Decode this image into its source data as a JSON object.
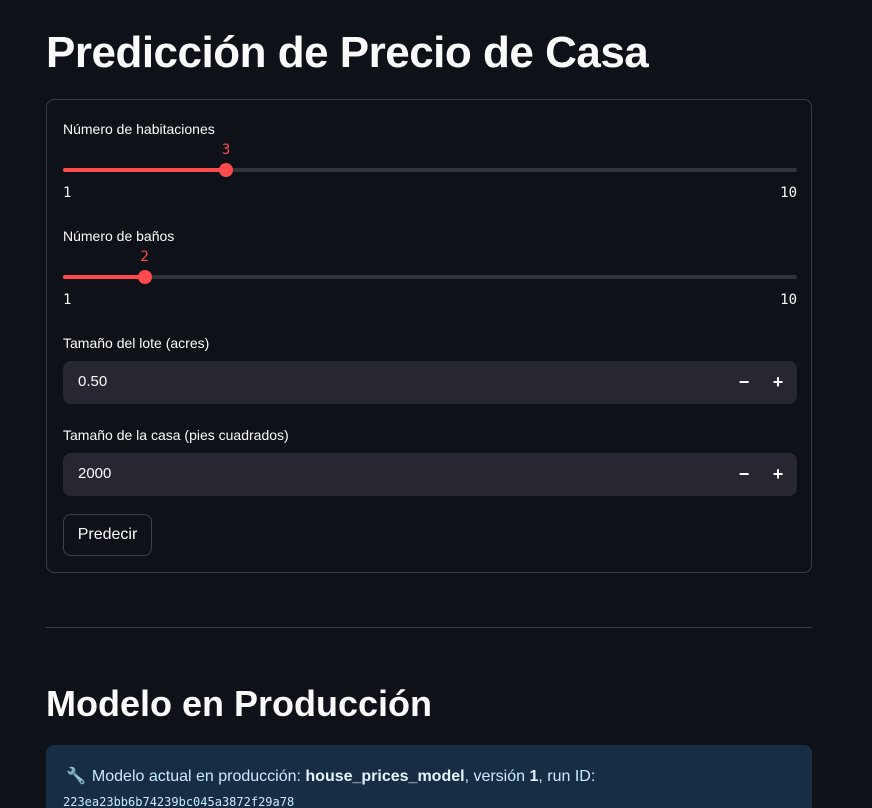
{
  "title": "Predicción de Precio de Casa",
  "form": {
    "bedrooms": {
      "label": "Número de habitaciones",
      "value": "3",
      "min": "1",
      "max": "10",
      "fraction": 0.2222
    },
    "bathrooms": {
      "label": "Número de baños",
      "value": "2",
      "min": "1",
      "max": "10",
      "fraction": 0.1111
    },
    "lot_size": {
      "label": "Tamaño del lote (acres)",
      "value": "0.50",
      "minus": "−",
      "plus": "+"
    },
    "house_size": {
      "label": "Tamaño de la casa (pies cuadrados)",
      "value": "2000",
      "minus": "−",
      "plus": "+"
    },
    "submit_label": "Predecir"
  },
  "model_section": {
    "heading": "Modelo en Producción",
    "info_icon": "wrench-icon",
    "info_prefix": "Modelo actual en producción: ",
    "model_name": "house_prices_model",
    "version_prefix": ", versión ",
    "version": "1",
    "run_prefix": ", run ID:",
    "run_id": "223ea23bb6b74239bc045a3872f29a78"
  },
  "colors": {
    "accent": "#ff4b4b",
    "background": "#0e1117",
    "info_bg": "#172d43"
  }
}
